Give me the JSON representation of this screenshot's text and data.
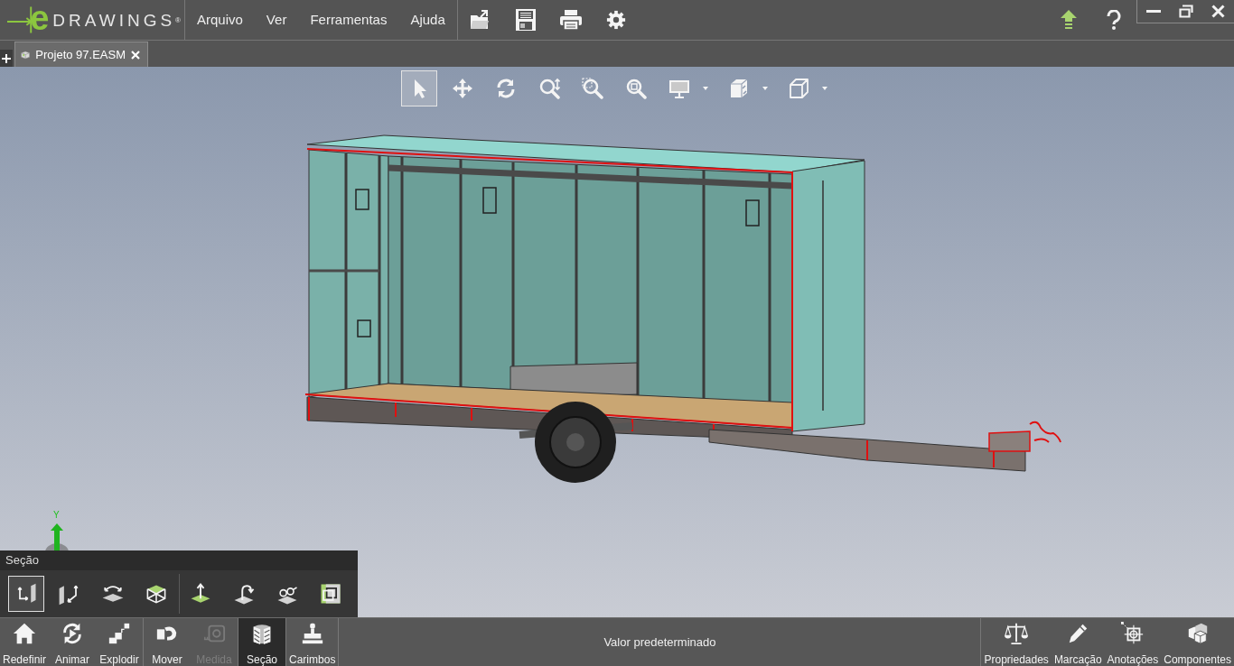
{
  "logo": {
    "letter": "e",
    "wordmark": "DRAWINGS$^{®}$"
  },
  "menu": [
    {
      "label": "Arquivo"
    },
    {
      "label": "Ver"
    },
    {
      "label": "Ferramentas"
    },
    {
      "label": "Ajuda"
    }
  ],
  "tabs": [
    {
      "label": "Projeto 97.EASM",
      "selected": true
    }
  ],
  "view_tools": [
    {
      "kind": "select",
      "selected": true,
      "dropdown": false
    },
    {
      "kind": "pan",
      "selected": false,
      "dropdown": false
    },
    {
      "kind": "rotate",
      "selected": false,
      "dropdown": false
    },
    {
      "kind": "zoom",
      "selected": false,
      "dropdown": false
    },
    {
      "kind": "zoom_area",
      "selected": false,
      "dropdown": false
    },
    {
      "kind": "zoom_fit",
      "selected": false,
      "dropdown": false
    },
    {
      "kind": "display",
      "selected": false,
      "dropdown": true
    },
    {
      "kind": "shaded_cube",
      "selected": false,
      "dropdown": true
    },
    {
      "kind": "wire_cube",
      "selected": false,
      "dropdown": true
    }
  ],
  "axis_triad": {
    "label": "Y"
  },
  "section_panel": {
    "title": "Seção",
    "tool_groups": [
      [
        {
          "kind": "plane_yx",
          "selected": true
        },
        {
          "kind": "plane_zy",
          "selected": false
        },
        {
          "kind": "plane_zx",
          "selected": false
        },
        {
          "kind": "box_top",
          "selected": false
        }
      ],
      [
        {
          "kind": "plane_up",
          "selected": false
        },
        {
          "kind": "plane_turn",
          "selected": false
        },
        {
          "kind": "plane_view",
          "selected": false
        },
        {
          "kind": "nested",
          "selected": false
        }
      ]
    ]
  },
  "bottom_bar": {
    "left_groups": [
      [
        {
          "label": "Redefinir",
          "kind": "home",
          "disabled": false,
          "selected": false
        },
        {
          "label": "Animar",
          "kind": "animate",
          "disabled": false,
          "selected": false
        },
        {
          "label": "Explodir",
          "kind": "explode",
          "disabled": false,
          "selected": false
        }
      ],
      [
        {
          "label": "Mover",
          "kind": "move",
          "disabled": false,
          "selected": false
        },
        {
          "label": "Medida",
          "kind": "measure",
          "disabled": true,
          "selected": false
        }
      ],
      [
        {
          "label": "Seção",
          "kind": "section",
          "disabled": false,
          "selected": true
        }
      ],
      [
        {
          "label": "Carimbos",
          "kind": "stamp",
          "disabled": false,
          "selected": false
        }
      ]
    ],
    "status": "Valor predeterminado",
    "right_tools": [
      {
        "label": "Propriedades",
        "kind": "properties"
      },
      {
        "label": "Marcação",
        "kind": "markup"
      },
      {
        "label": "Anotações",
        "kind": "annotations"
      },
      {
        "label": "Componentes",
        "kind": "components"
      }
    ]
  }
}
